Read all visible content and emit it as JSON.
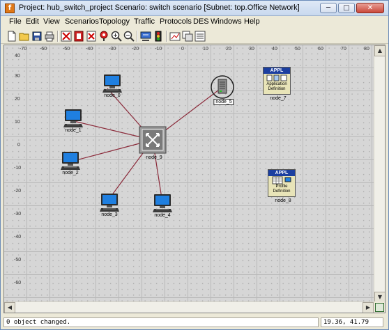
{
  "window": {
    "title": "Project: hub_switch_project Scenario: switch scenario  [Subnet: top.Office Network]",
    "app_icon_letter": "f",
    "minimize_glyph": "─",
    "maximize_glyph": "□",
    "close_glyph": "✕"
  },
  "menubar": {
    "items": [
      "File",
      "Edit",
      "View",
      "Scenarios",
      "Topology",
      "Traffic",
      "Protocols",
      "DES",
      "Windows",
      "Help"
    ]
  },
  "toolbar": {
    "icons": [
      "new-icon",
      "open-icon",
      "save-icon",
      "print-icon",
      "object-palette-icon",
      "configure-icon",
      "remove-icon",
      "place-icon",
      "zoom-in-icon",
      "zoom-out-icon",
      "run-simulation-icon",
      "view-results-icon",
      "hide-graphs-icon",
      "close-graphs-icon",
      "duplicate-icon",
      "compare-icon"
    ]
  },
  "canvas": {
    "ruler_x": [
      "-70",
      "-60",
      "-50",
      "-40",
      "-30",
      "-20",
      "-10",
      "0",
      "10",
      "20",
      "30",
      "40",
      "50",
      "60",
      "70",
      "80"
    ],
    "ruler_y": [
      "40",
      "30",
      "20",
      "10",
      "0",
      "-10",
      "-20",
      "-30",
      "-40",
      "-50",
      "-60"
    ],
    "nodes": {
      "node_0": "node_0",
      "node_1": "node_1",
      "node_2": "node_2",
      "node_3": "node_3",
      "node_4": "node_4",
      "node_5": "node_5",
      "node_7": "node_7",
      "node_8": "node_8",
      "node_9": "node_9"
    },
    "app_def": {
      "badge": "APPL",
      "line1": "Application",
      "line2": "Definition"
    },
    "profile_def": {
      "badge": "APPL",
      "line1": "Profile",
      "line2": "Definition"
    },
    "link_color": "#8b2a3a"
  },
  "statusbar": {
    "message": "0 object changed.",
    "coords": "19.36, 41.79"
  }
}
